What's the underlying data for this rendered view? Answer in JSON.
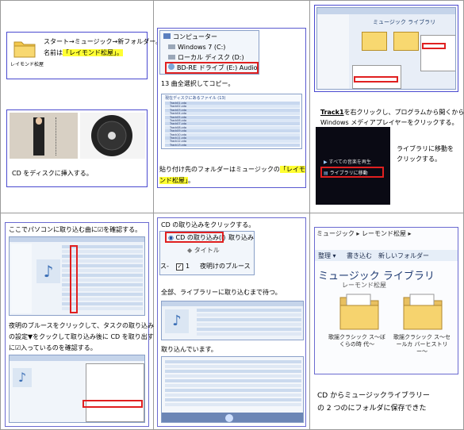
{
  "cell1": {
    "folder_caption": "レイモンド松屋",
    "line1": "スタート→ミュージック→新フォルダー。",
    "line2_prefix": "名前は",
    "line2_highlight": "「レイモンド松屋」。",
    "caption": "CD をディスクに挿入する。"
  },
  "cell2": {
    "tree": [
      "コンピューター",
      "Windows 7 (C:)",
      "ローカル ディスク (D:)",
      "BD-RE ドライブ (E:) Audio CD"
    ],
    "line1": "13 曲全選択してコピー。",
    "list_header": "現在ディスクにあるファイル (13)",
    "track_names": [
      "Track01.cda",
      "Track02.cda",
      "Track03.cda",
      "Track04.cda",
      "Track05.cda",
      "Track06.cda",
      "Track07.cda",
      "Track08.cda",
      "Track09.cda",
      "Track10.cda",
      "Track11.cda",
      "Track12.cda",
      "Track13.cda"
    ],
    "caption_prefix": "貼り付け先のフォルダーはミュージックの",
    "caption_highlight_1": "「レイモ",
    "caption_highlight_2": "ンド松屋」",
    "caption_suffix": "。"
  },
  "cell3": {
    "lib_title": "ミュージック ライブラリ",
    "line1_bold": "Track1",
    "line1_rest": "を右クリックし、プログラムから開くから",
    "line2": "Windows メディアプレイヤーをクリックする。",
    "menu_item1": "すべての音楽を再生",
    "menu_item2": "ライブラリに移動",
    "side_text1": "ライブラリに移動を",
    "side_text2": "クリックする。"
  },
  "cell4": {
    "line1": "ここでパソコンに取り込む曲に☑を確認する。",
    "line2": "夜明のブルースをクリックして、タスクの取り込み",
    "line3": "の設定▼をクックして取り込み後に CD を取り出す",
    "line4": "に☑入っているのを確認する。"
  },
  "cell5": {
    "line1": "CD の取り込みをクリックする。",
    "btn_label": "CD の取り込み(I)",
    "btn_right": "取り込みの",
    "row_title": "タイトル",
    "row_song_num": "1",
    "row_song": "夜明けのブルース",
    "left_frag": "ス-",
    "line2": "全部、ライブラリーに取り込むまで待つ。",
    "line3": "取り込んでいます。"
  },
  "cell6": {
    "breadcrumb": "ミュージック ▸ レーモンド松屋 ▸",
    "toolbar": [
      "整理 ▾",
      "書き込む",
      "新しいフォルダー"
    ],
    "lib_title": "ミュージック ライブラリ",
    "lib_sub": "レーモンド松屋",
    "folder1": "歌謡クラシック ス〜ぼくらの時 代〜",
    "folder2": "歌謡クラシック ス〜セールカ バーヒストリ ー〜",
    "caption1": "CD からミュージックライブラリー",
    "caption2": "の 2 つのにフォルダに保存できた"
  }
}
